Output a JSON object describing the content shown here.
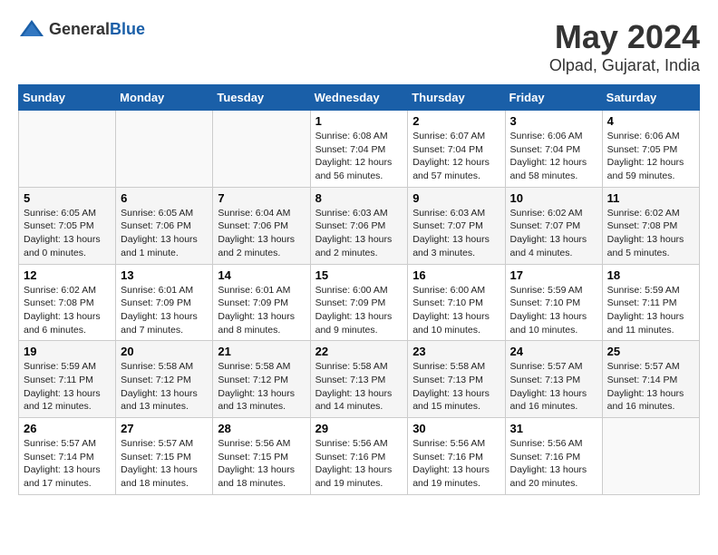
{
  "header": {
    "logo_general": "General",
    "logo_blue": "Blue",
    "month_year": "May 2024",
    "location": "Olpad, Gujarat, India"
  },
  "weekdays": [
    "Sunday",
    "Monday",
    "Tuesday",
    "Wednesday",
    "Thursday",
    "Friday",
    "Saturday"
  ],
  "weeks": [
    [
      {
        "day": "",
        "info": ""
      },
      {
        "day": "",
        "info": ""
      },
      {
        "day": "",
        "info": ""
      },
      {
        "day": "1",
        "info": "Sunrise: 6:08 AM\nSunset: 7:04 PM\nDaylight: 12 hours and 56 minutes."
      },
      {
        "day": "2",
        "info": "Sunrise: 6:07 AM\nSunset: 7:04 PM\nDaylight: 12 hours and 57 minutes."
      },
      {
        "day": "3",
        "info": "Sunrise: 6:06 AM\nSunset: 7:04 PM\nDaylight: 12 hours and 58 minutes."
      },
      {
        "day": "4",
        "info": "Sunrise: 6:06 AM\nSunset: 7:05 PM\nDaylight: 12 hours and 59 minutes."
      }
    ],
    [
      {
        "day": "5",
        "info": "Sunrise: 6:05 AM\nSunset: 7:05 PM\nDaylight: 13 hours and 0 minutes."
      },
      {
        "day": "6",
        "info": "Sunrise: 6:05 AM\nSunset: 7:06 PM\nDaylight: 13 hours and 1 minute."
      },
      {
        "day": "7",
        "info": "Sunrise: 6:04 AM\nSunset: 7:06 PM\nDaylight: 13 hours and 2 minutes."
      },
      {
        "day": "8",
        "info": "Sunrise: 6:03 AM\nSunset: 7:06 PM\nDaylight: 13 hours and 2 minutes."
      },
      {
        "day": "9",
        "info": "Sunrise: 6:03 AM\nSunset: 7:07 PM\nDaylight: 13 hours and 3 minutes."
      },
      {
        "day": "10",
        "info": "Sunrise: 6:02 AM\nSunset: 7:07 PM\nDaylight: 13 hours and 4 minutes."
      },
      {
        "day": "11",
        "info": "Sunrise: 6:02 AM\nSunset: 7:08 PM\nDaylight: 13 hours and 5 minutes."
      }
    ],
    [
      {
        "day": "12",
        "info": "Sunrise: 6:02 AM\nSunset: 7:08 PM\nDaylight: 13 hours and 6 minutes."
      },
      {
        "day": "13",
        "info": "Sunrise: 6:01 AM\nSunset: 7:09 PM\nDaylight: 13 hours and 7 minutes."
      },
      {
        "day": "14",
        "info": "Sunrise: 6:01 AM\nSunset: 7:09 PM\nDaylight: 13 hours and 8 minutes."
      },
      {
        "day": "15",
        "info": "Sunrise: 6:00 AM\nSunset: 7:09 PM\nDaylight: 13 hours and 9 minutes."
      },
      {
        "day": "16",
        "info": "Sunrise: 6:00 AM\nSunset: 7:10 PM\nDaylight: 13 hours and 10 minutes."
      },
      {
        "day": "17",
        "info": "Sunrise: 5:59 AM\nSunset: 7:10 PM\nDaylight: 13 hours and 10 minutes."
      },
      {
        "day": "18",
        "info": "Sunrise: 5:59 AM\nSunset: 7:11 PM\nDaylight: 13 hours and 11 minutes."
      }
    ],
    [
      {
        "day": "19",
        "info": "Sunrise: 5:59 AM\nSunset: 7:11 PM\nDaylight: 13 hours and 12 minutes."
      },
      {
        "day": "20",
        "info": "Sunrise: 5:58 AM\nSunset: 7:12 PM\nDaylight: 13 hours and 13 minutes."
      },
      {
        "day": "21",
        "info": "Sunrise: 5:58 AM\nSunset: 7:12 PM\nDaylight: 13 hours and 13 minutes."
      },
      {
        "day": "22",
        "info": "Sunrise: 5:58 AM\nSunset: 7:13 PM\nDaylight: 13 hours and 14 minutes."
      },
      {
        "day": "23",
        "info": "Sunrise: 5:58 AM\nSunset: 7:13 PM\nDaylight: 13 hours and 15 minutes."
      },
      {
        "day": "24",
        "info": "Sunrise: 5:57 AM\nSunset: 7:13 PM\nDaylight: 13 hours and 16 minutes."
      },
      {
        "day": "25",
        "info": "Sunrise: 5:57 AM\nSunset: 7:14 PM\nDaylight: 13 hours and 16 minutes."
      }
    ],
    [
      {
        "day": "26",
        "info": "Sunrise: 5:57 AM\nSunset: 7:14 PM\nDaylight: 13 hours and 17 minutes."
      },
      {
        "day": "27",
        "info": "Sunrise: 5:57 AM\nSunset: 7:15 PM\nDaylight: 13 hours and 18 minutes."
      },
      {
        "day": "28",
        "info": "Sunrise: 5:56 AM\nSunset: 7:15 PM\nDaylight: 13 hours and 18 minutes."
      },
      {
        "day": "29",
        "info": "Sunrise: 5:56 AM\nSunset: 7:16 PM\nDaylight: 13 hours and 19 minutes."
      },
      {
        "day": "30",
        "info": "Sunrise: 5:56 AM\nSunset: 7:16 PM\nDaylight: 13 hours and 19 minutes."
      },
      {
        "day": "31",
        "info": "Sunrise: 5:56 AM\nSunset: 7:16 PM\nDaylight: 13 hours and 20 minutes."
      },
      {
        "day": "",
        "info": ""
      }
    ]
  ]
}
